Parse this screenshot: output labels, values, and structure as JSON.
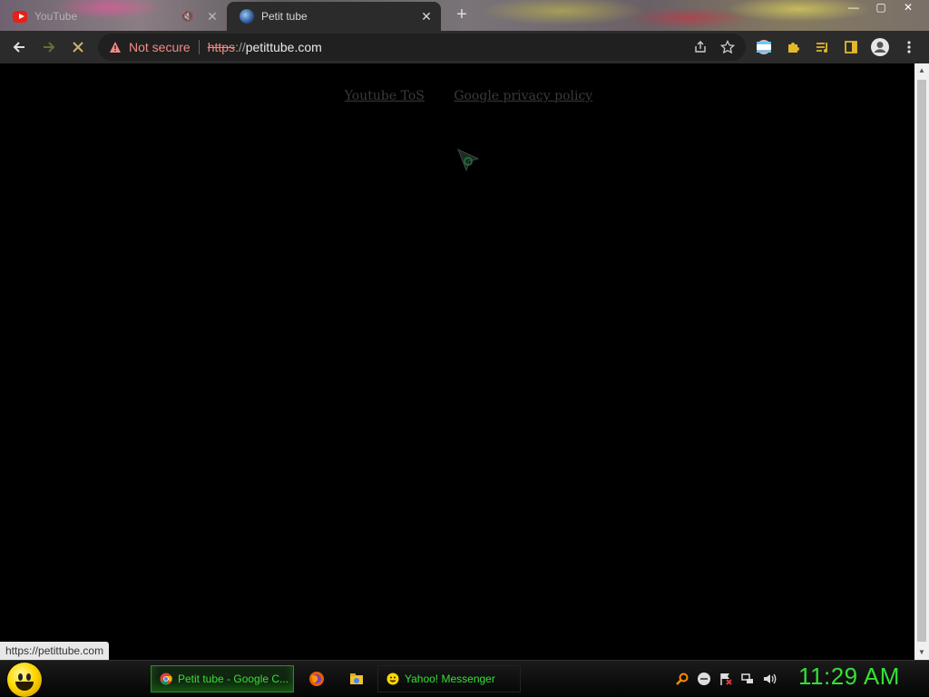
{
  "browser": {
    "tabs": [
      {
        "title": "YouTube",
        "active": false,
        "favicon": "youtube-icon",
        "audio_icon": "speaker-muted-icon"
      },
      {
        "title": "Petit tube",
        "active": true,
        "favicon": "petittube-globe-icon"
      }
    ],
    "new_tab_glyph": "+",
    "window_controls": {
      "minimize": "—",
      "maximize": "▢",
      "close": "✕"
    },
    "toolbar": {
      "back_icon": "arrow-left-icon",
      "forward_icon": "arrow-right-icon",
      "stop_icon": "close-icon",
      "omnibox": {
        "security_label": "Not secure",
        "url_scheme": "https",
        "url_slashes": "://",
        "url_host": "petittube.com"
      },
      "extensions": [
        "share-icon",
        "star-icon",
        "profile-flag-icon",
        "puzzle-icon",
        "media-queue-icon",
        "side-panel-icon",
        "account-icon",
        "menu-dots-icon"
      ]
    }
  },
  "page": {
    "links": [
      "Youtube ToS",
      "Google privacy policy"
    ]
  },
  "status_bubble": "https://petittube.com",
  "taskbar": {
    "items": [
      {
        "label": "Petit tube - Google C...",
        "icon": "chrome-icon",
        "active": true
      },
      {
        "label": "",
        "icon": "firefox-icon"
      },
      {
        "label": "",
        "icon": "file-explorer-icon"
      },
      {
        "label": "Yahoo! Messenger",
        "icon": "yahoo-smiley-icon"
      }
    ],
    "tray_icons": [
      "search-icon",
      "messenger-status-icon",
      "action-center-flag-icon",
      "network-icon",
      "volume-icon"
    ],
    "clock": "11:29 AM"
  },
  "colors": {
    "accent_green": "#35e035",
    "not_secure_red": "#f28b82",
    "toolbar_bg": "#2b2b2b"
  }
}
